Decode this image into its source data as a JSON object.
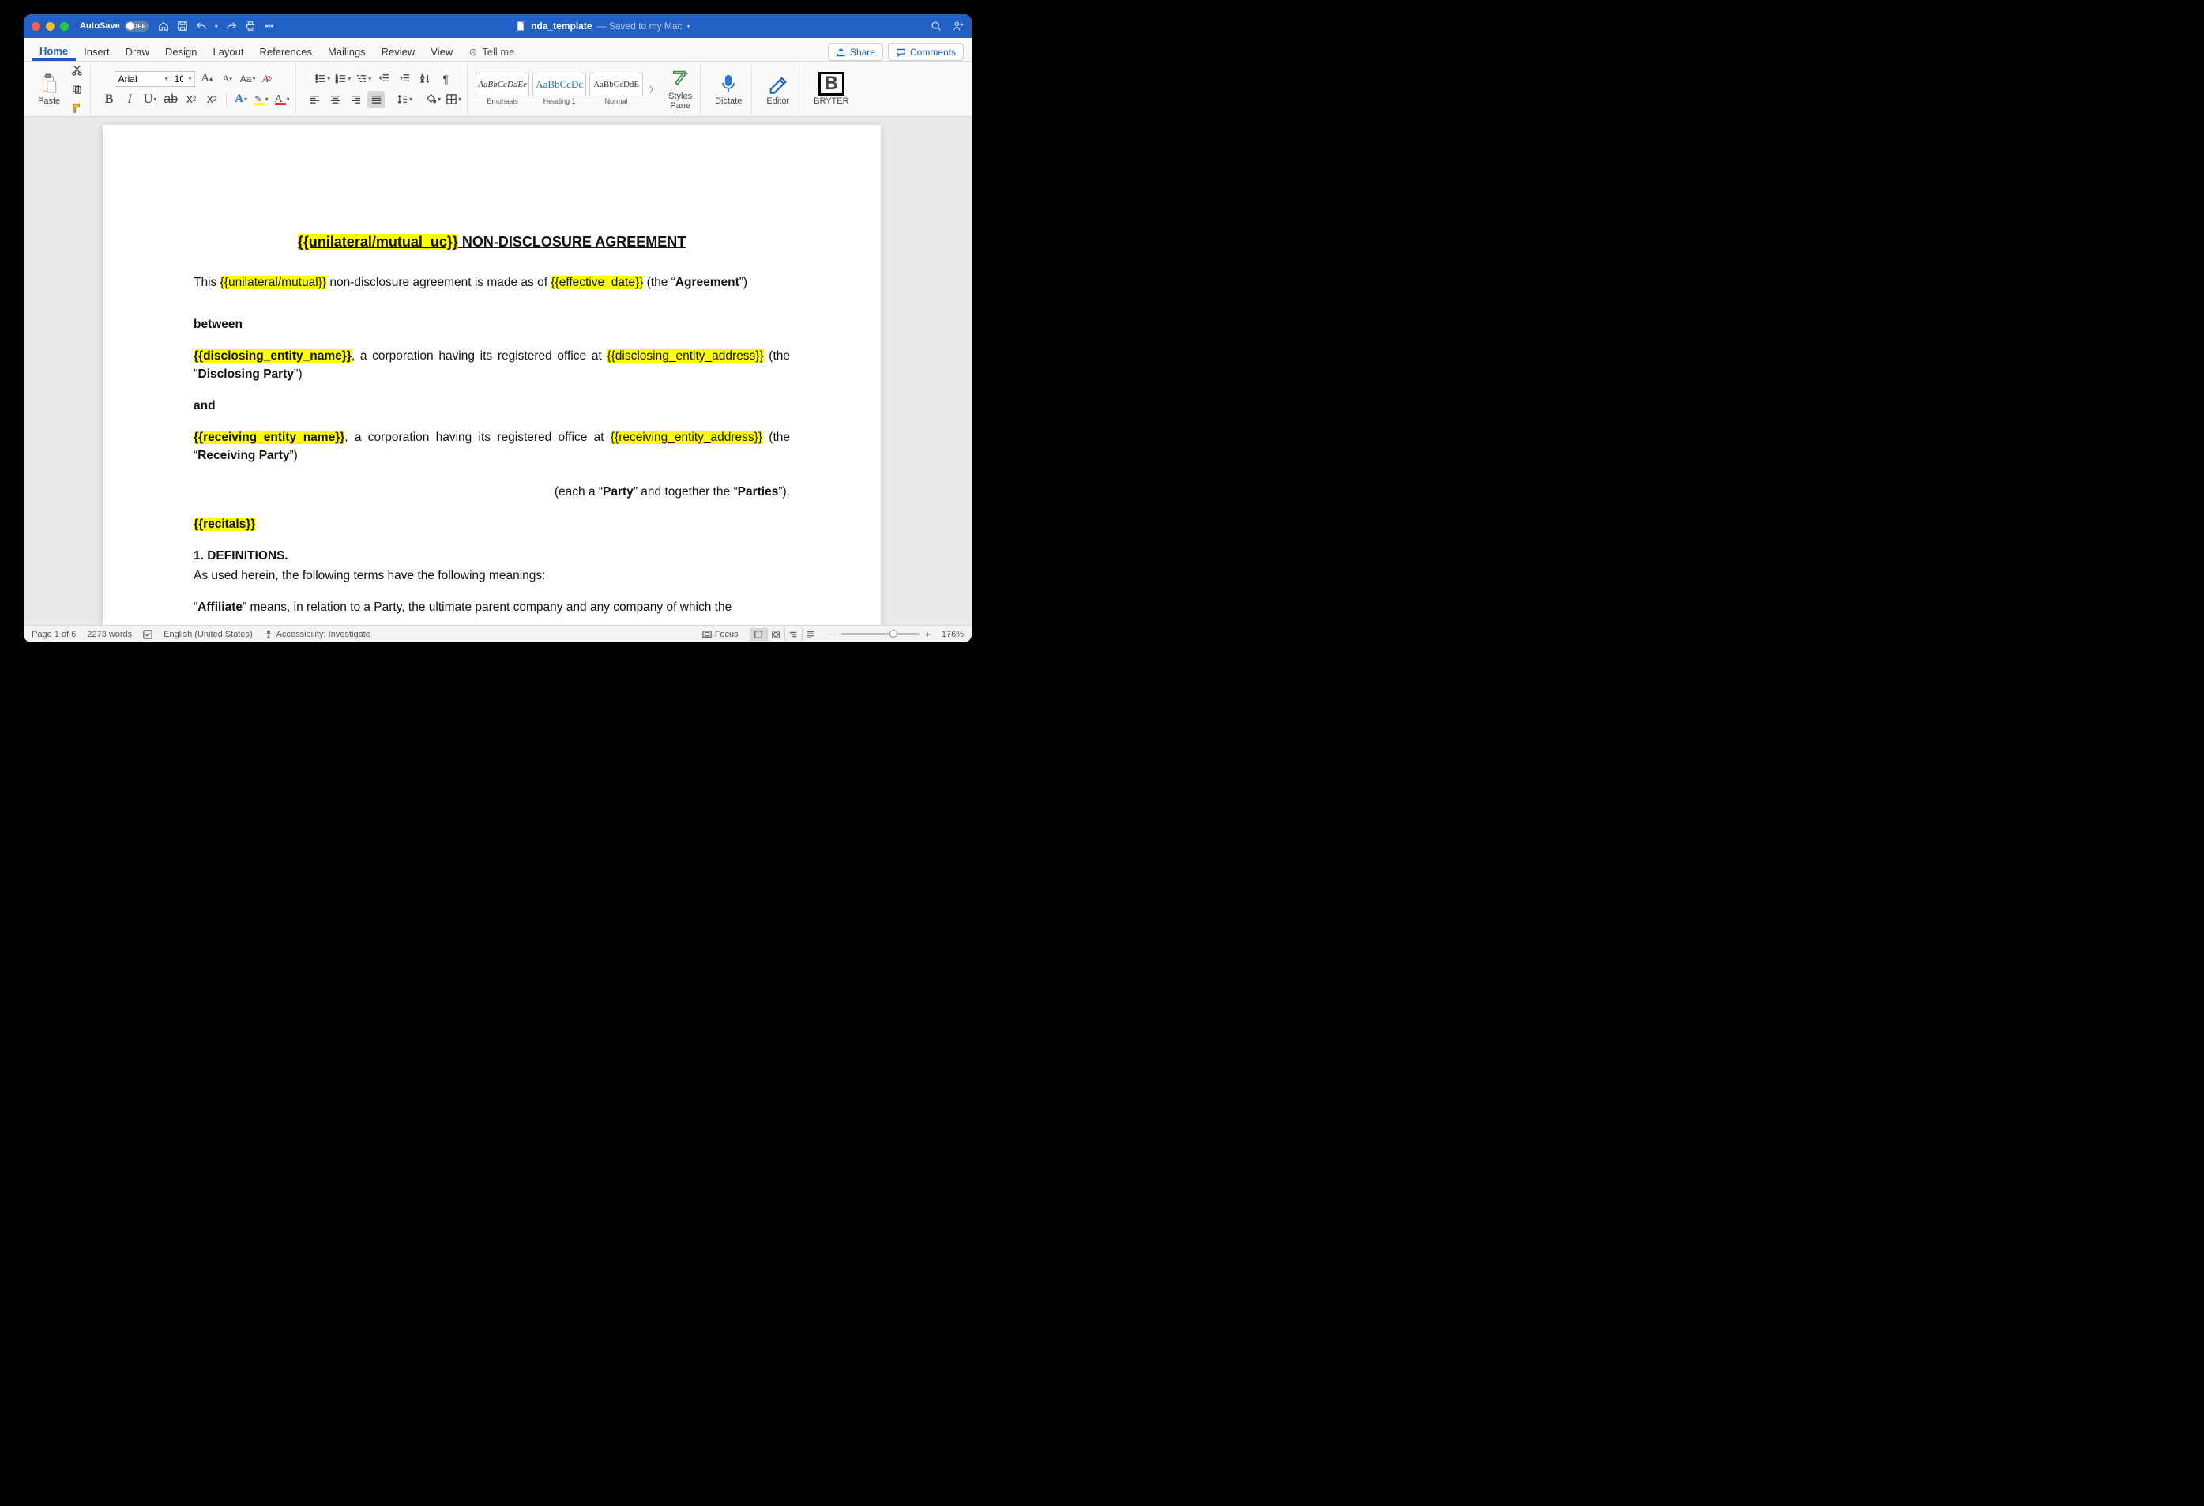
{
  "titlebar": {
    "autosave_label": "AutoSave",
    "autosave_off": "OFF",
    "filename": "nda_template",
    "filestatus": "— Saved to my Mac"
  },
  "tabs": {
    "items": [
      "Home",
      "Insert",
      "Draw",
      "Design",
      "Layout",
      "References",
      "Mailings",
      "Review",
      "View"
    ],
    "tellme": "Tell me",
    "share": "Share",
    "comments": "Comments"
  },
  "ribbon": {
    "paste": "Paste",
    "font_name": "Arial",
    "font_size": "10",
    "styles": {
      "items": [
        {
          "sample": "AaBbCcDdEe",
          "name": "Emphasis",
          "color": "#333",
          "italic": true
        },
        {
          "sample": "AaBbCcDc",
          "name": "Heading 1",
          "color": "#1f6fc5",
          "italic": false
        },
        {
          "sample": "AaBbCcDdE",
          "name": "Normal",
          "color": "#333",
          "italic": false
        }
      ],
      "pane": "Styles\nPane"
    },
    "dictate": "Dictate",
    "editor": "Editor",
    "bryter": "BRYTER"
  },
  "document": {
    "title_pre": "{{unilateral/mutual_uc}}",
    "title_post": " NON-DISCLOSURE AGREEMENT",
    "p1_a": "This ",
    "p1_hl1": "{{unilateral/mutual}}",
    "p1_b": " non-disclosure agreement is made as of ",
    "p1_hl2": "{{effective_date}}",
    "p1_c": " (the “",
    "p1_bold": "Agreement",
    "p1_d": "”)",
    "between": "between",
    "disc_name": "{{disclosing_entity_name}}",
    "disc_mid": ", a corporation having its registered office at ",
    "disc_addr": "{{disclosing_entity_address}}",
    "disc_tail_a": " (the \"",
    "disc_bold": "Disclosing Party",
    "disc_tail_b": "\")",
    "and": "and",
    "recv_name": "{{receiving_entity_name}}",
    "recv_mid": ", a corporation having its registered office at ",
    "recv_addr": "{{receiving_entity_address}}",
    "recv_tail_a": " (the “",
    "recv_bold": "Receiving Party",
    "recv_tail_b": "”)",
    "parties_a": "(each a “",
    "parties_b1": "Party",
    "parties_c": "” and together the “",
    "parties_b2": "Parties",
    "parties_d": "”).",
    "recitals": "{{recitals}}",
    "defs_head": "1. DEFINITIONS.",
    "defs_intro": "As used herein, the following terms have the following meanings:",
    "aff_a": "“",
    "aff_bold": "Affiliate",
    "aff_b": "” means, in relation to a Party, the ultimate parent company and any company of which the"
  },
  "status": {
    "page": "Page 1 of 6",
    "words": "2273 words",
    "lang": "English (United States)",
    "access": "Accessibility: Investigate",
    "focus": "Focus",
    "zoom": "176%"
  }
}
